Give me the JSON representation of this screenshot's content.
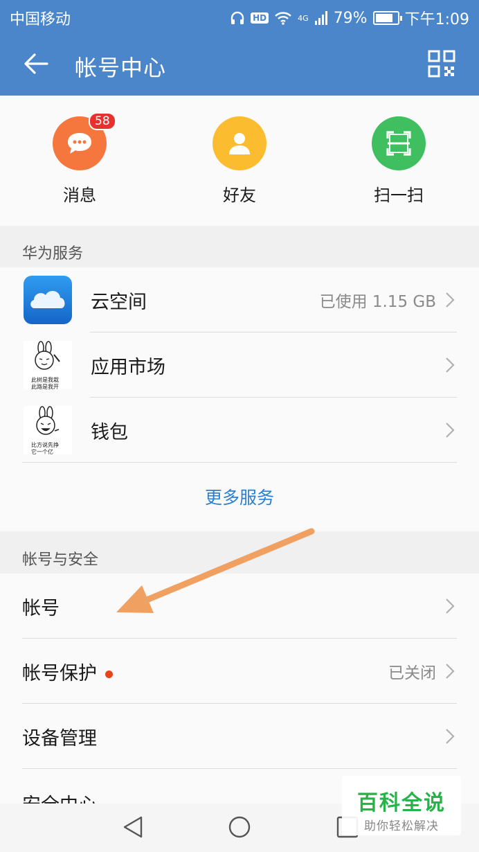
{
  "status_bar": {
    "carrier": "中国移动",
    "hd_label": "HD",
    "network": "4G",
    "battery": "79%",
    "battery_level": 0.79,
    "time": "下午1:09"
  },
  "app_bar": {
    "title": "帐号中心"
  },
  "quick_actions": [
    {
      "label": "消息",
      "badge": "58",
      "color": "#f5773d",
      "icon": "chat-bubble-icon"
    },
    {
      "label": "好友",
      "color": "#fbbd2f",
      "icon": "person-icon"
    },
    {
      "label": "扫一扫",
      "color": "#3fbf5f",
      "icon": "scan-icon"
    }
  ],
  "huawei_services": {
    "header": "华为服务",
    "items": [
      {
        "label": "云空间",
        "value": "已使用 1.15 GB",
        "icon": "cloud-icon"
      },
      {
        "label": "应用市场",
        "value": "",
        "icon": "rabbit-meme-icon",
        "meme_text": [
          "此树是我栽",
          "此路是我开"
        ]
      },
      {
        "label": "钱包",
        "value": "",
        "icon": "rabbit-meme-icon",
        "meme_text": [
          "比方说先挣",
          "它一个亿"
        ]
      }
    ],
    "more_link": "更多服务"
  },
  "account_security": {
    "header": "帐号与安全",
    "items": [
      {
        "label": "帐号",
        "value": ""
      },
      {
        "label": "帐号保护",
        "value": "已关闭",
        "dot": true
      },
      {
        "label": "设备管理",
        "value": ""
      },
      {
        "label": "安全中心",
        "value": ""
      }
    ]
  },
  "watermark": {
    "title": "百科全说",
    "subtitle": "助你轻松解决"
  },
  "colors": {
    "primary": "#4a86c9",
    "link": "#2a7fd4",
    "arrow": "#f0a060"
  }
}
